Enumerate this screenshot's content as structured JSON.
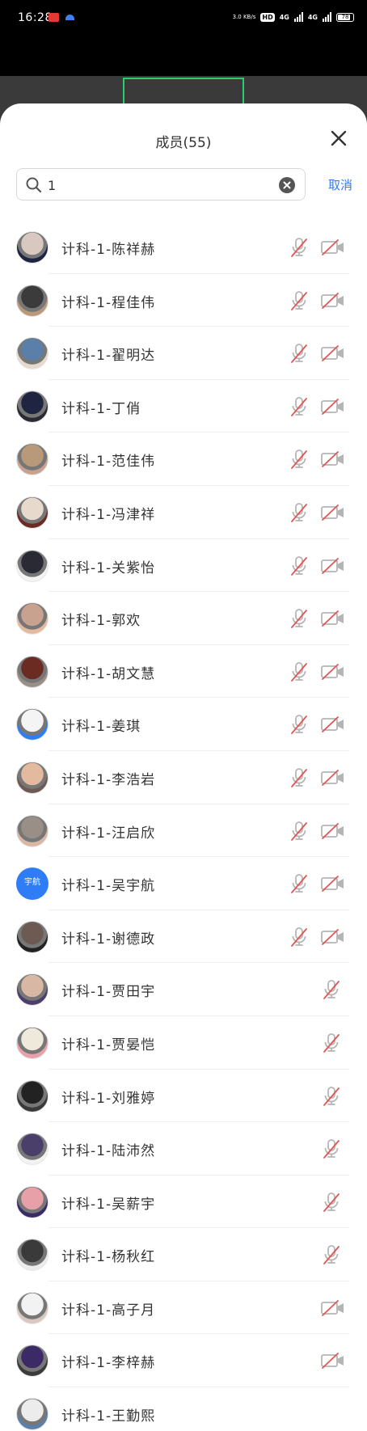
{
  "status_bar": {
    "time": "16:28",
    "speed": "3.0 KB/s",
    "hd": "HD",
    "net1": "4G",
    "net2": "4G",
    "battery": "78"
  },
  "sheet": {
    "title": "成员(55)",
    "search_value": "1",
    "cancel_label": "取消"
  },
  "colors": {
    "accent": "#2f7df6",
    "muted_red": "#e25555",
    "icon_gray": "#b5b5b5",
    "active_tile_border": "#2ecc71"
  },
  "members": [
    {
      "name": "计科-1-陈祥赫",
      "mic": true,
      "cam": true
    },
    {
      "name": "计科-1-程佳伟",
      "mic": true,
      "cam": true
    },
    {
      "name": "计科-1-翟明达",
      "mic": true,
      "cam": true
    },
    {
      "name": "计科-1-丁俏",
      "mic": true,
      "cam": true
    },
    {
      "name": "计科-1-范佳伟",
      "mic": true,
      "cam": true
    },
    {
      "name": "计科-1-冯津祥",
      "mic": true,
      "cam": true
    },
    {
      "name": "计科-1-关紫怡",
      "mic": true,
      "cam": true
    },
    {
      "name": "计科-1-郭欢",
      "mic": true,
      "cam": true
    },
    {
      "name": "计科-1-胡文慧",
      "mic": true,
      "cam": true
    },
    {
      "name": "计科-1-姜琪",
      "mic": true,
      "cam": true
    },
    {
      "name": "计科-1-李浩岩",
      "mic": true,
      "cam": true
    },
    {
      "name": "计科-1-汪启欣",
      "mic": true,
      "cam": true
    },
    {
      "name": "计科-1-吴宇航",
      "mic": true,
      "cam": true,
      "avatar_text": "宇航"
    },
    {
      "name": "计科-1-谢德政",
      "mic": true,
      "cam": true
    },
    {
      "name": "计科-1-贾田宇",
      "mic": true,
      "cam": false
    },
    {
      "name": "计科-1-贾晏恺",
      "mic": true,
      "cam": false
    },
    {
      "name": "计科-1-刘雅婷",
      "mic": true,
      "cam": false
    },
    {
      "name": "计科-1-陆沛然",
      "mic": true,
      "cam": false
    },
    {
      "name": "计科-1-吴薪宇",
      "mic": true,
      "cam": false
    },
    {
      "name": "计科-1-杨秋红",
      "mic": true,
      "cam": false
    },
    {
      "name": "计科-1-高子月",
      "mic": false,
      "cam": true
    },
    {
      "name": "计科-1-李梓赫",
      "mic": false,
      "cam": true
    },
    {
      "name": "计科-1-王勤熙",
      "mic": false,
      "cam": false
    }
  ]
}
